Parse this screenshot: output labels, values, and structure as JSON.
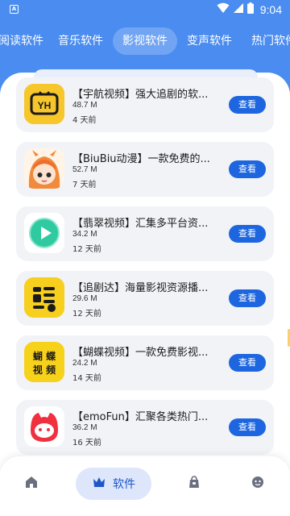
{
  "status_bar": {
    "app_badge": "A",
    "time": "9:04"
  },
  "tabs": [
    {
      "label": "阅读软件"
    },
    {
      "label": "音乐软件"
    },
    {
      "label": "影视软件",
      "active": true
    },
    {
      "label": "变声软件"
    },
    {
      "label": "热门软件"
    }
  ],
  "apps": [
    {
      "title": "【宇航视频】强大追剧的软...",
      "size": "48.7 M",
      "date": "4 天前",
      "button": "查看",
      "logo_text": "YH"
    },
    {
      "title": "【BiuBiu动漫】一款免费的...",
      "size": "52.7 M",
      "date": "7 天前",
      "button": "查看",
      "logo_text": ""
    },
    {
      "title": "【翡翠视频】汇集多平台资...",
      "size": "34.2 M",
      "date": "12 天前",
      "button": "查看",
      "logo_text": ""
    },
    {
      "title": "【追剧达】海量影视资源播...",
      "size": "29.6 M",
      "date": "12 天前",
      "button": "查看",
      "logo_text": ""
    },
    {
      "title": "【蝴蝶视频】一款免费影视...",
      "size": "24.2 M",
      "date": "14 天前",
      "button": "查看",
      "logo_text_line1": "蝴 蝶",
      "logo_text_line2": "视 频"
    },
    {
      "title": "【emoFun】汇聚各类热门...",
      "size": "36.2 M",
      "date": "16 天前",
      "button": "查看",
      "logo_text": ""
    }
  ],
  "bottom_nav": {
    "items": [
      {
        "icon": "home-icon"
      },
      {
        "icon": "crown-icon",
        "label": "软件",
        "active": true
      },
      {
        "icon": "bag-icon"
      },
      {
        "icon": "profile-icon"
      }
    ]
  },
  "colors": {
    "accent": "#1d66e0",
    "header_bg": "#4a8cf0",
    "card_bg": "#f1f3f7"
  }
}
